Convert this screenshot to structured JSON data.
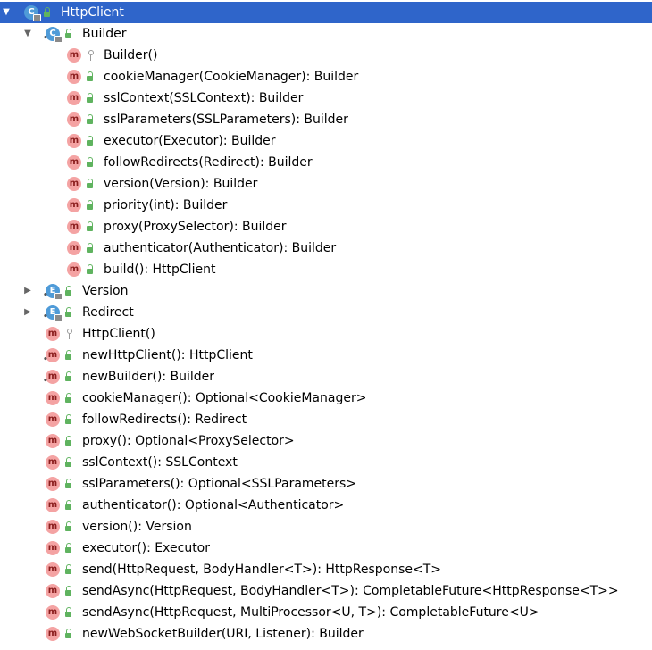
{
  "tree": [
    {
      "depth": 0,
      "arrow": "expanded",
      "kind": "c",
      "static": false,
      "vis": "public",
      "selected": true,
      "label": "HttpClient"
    },
    {
      "depth": 1,
      "arrow": "expanded",
      "kind": "c",
      "static": true,
      "vis": "public",
      "selected": false,
      "label": "Builder"
    },
    {
      "depth": 2,
      "arrow": "none",
      "kind": "m",
      "static": false,
      "vis": "private",
      "selected": false,
      "label": "Builder()"
    },
    {
      "depth": 2,
      "arrow": "none",
      "kind": "m",
      "static": false,
      "vis": "public",
      "selected": false,
      "label": "cookieManager(CookieManager): Builder"
    },
    {
      "depth": 2,
      "arrow": "none",
      "kind": "m",
      "static": false,
      "vis": "public",
      "selected": false,
      "label": "sslContext(SSLContext): Builder"
    },
    {
      "depth": 2,
      "arrow": "none",
      "kind": "m",
      "static": false,
      "vis": "public",
      "selected": false,
      "label": "sslParameters(SSLParameters): Builder"
    },
    {
      "depth": 2,
      "arrow": "none",
      "kind": "m",
      "static": false,
      "vis": "public",
      "selected": false,
      "label": "executor(Executor): Builder"
    },
    {
      "depth": 2,
      "arrow": "none",
      "kind": "m",
      "static": false,
      "vis": "public",
      "selected": false,
      "label": "followRedirects(Redirect): Builder"
    },
    {
      "depth": 2,
      "arrow": "none",
      "kind": "m",
      "static": false,
      "vis": "public",
      "selected": false,
      "label": "version(Version): Builder"
    },
    {
      "depth": 2,
      "arrow": "none",
      "kind": "m",
      "static": false,
      "vis": "public",
      "selected": false,
      "label": "priority(int): Builder"
    },
    {
      "depth": 2,
      "arrow": "none",
      "kind": "m",
      "static": false,
      "vis": "public",
      "selected": false,
      "label": "proxy(ProxySelector): Builder"
    },
    {
      "depth": 2,
      "arrow": "none",
      "kind": "m",
      "static": false,
      "vis": "public",
      "selected": false,
      "label": "authenticator(Authenticator): Builder"
    },
    {
      "depth": 2,
      "arrow": "none",
      "kind": "m",
      "static": false,
      "vis": "public",
      "selected": false,
      "label": "build(): HttpClient"
    },
    {
      "depth": 1,
      "arrow": "collapsed",
      "kind": "e",
      "static": true,
      "vis": "public",
      "selected": false,
      "label": "Version"
    },
    {
      "depth": 1,
      "arrow": "collapsed",
      "kind": "e",
      "static": true,
      "vis": "public",
      "selected": false,
      "label": "Redirect"
    },
    {
      "depth": 1,
      "arrow": "none",
      "kind": "m",
      "static": false,
      "vis": "private",
      "selected": false,
      "label": "HttpClient()"
    },
    {
      "depth": 1,
      "arrow": "none",
      "kind": "m",
      "static": true,
      "vis": "public",
      "selected": false,
      "label": "newHttpClient(): HttpClient"
    },
    {
      "depth": 1,
      "arrow": "none",
      "kind": "m",
      "static": true,
      "vis": "public",
      "selected": false,
      "label": "newBuilder(): Builder"
    },
    {
      "depth": 1,
      "arrow": "none",
      "kind": "m",
      "static": false,
      "vis": "public",
      "selected": false,
      "label": "cookieManager(): Optional<CookieManager>"
    },
    {
      "depth": 1,
      "arrow": "none",
      "kind": "m",
      "static": false,
      "vis": "public",
      "selected": false,
      "label": "followRedirects(): Redirect"
    },
    {
      "depth": 1,
      "arrow": "none",
      "kind": "m",
      "static": false,
      "vis": "public",
      "selected": false,
      "label": "proxy(): Optional<ProxySelector>"
    },
    {
      "depth": 1,
      "arrow": "none",
      "kind": "m",
      "static": false,
      "vis": "public",
      "selected": false,
      "label": "sslContext(): SSLContext"
    },
    {
      "depth": 1,
      "arrow": "none",
      "kind": "m",
      "static": false,
      "vis": "public",
      "selected": false,
      "label": "sslParameters(): Optional<SSLParameters>"
    },
    {
      "depth": 1,
      "arrow": "none",
      "kind": "m",
      "static": false,
      "vis": "public",
      "selected": false,
      "label": "authenticator(): Optional<Authenticator>"
    },
    {
      "depth": 1,
      "arrow": "none",
      "kind": "m",
      "static": false,
      "vis": "public",
      "selected": false,
      "label": "version(): Version"
    },
    {
      "depth": 1,
      "arrow": "none",
      "kind": "m",
      "static": false,
      "vis": "public",
      "selected": false,
      "label": "executor(): Executor"
    },
    {
      "depth": 1,
      "arrow": "none",
      "kind": "m",
      "static": false,
      "vis": "public",
      "selected": false,
      "label": "send(HttpRequest, BodyHandler<T>): HttpResponse<T>"
    },
    {
      "depth": 1,
      "arrow": "none",
      "kind": "m",
      "static": false,
      "vis": "public",
      "selected": false,
      "label": "sendAsync(HttpRequest, BodyHandler<T>): CompletableFuture<HttpResponse<T>>"
    },
    {
      "depth": 1,
      "arrow": "none",
      "kind": "m",
      "static": false,
      "vis": "public",
      "selected": false,
      "label": "sendAsync(HttpRequest, MultiProcessor<U, T>): CompletableFuture<U>"
    },
    {
      "depth": 1,
      "arrow": "none",
      "kind": "m",
      "static": false,
      "vis": "public",
      "selected": false,
      "label": "newWebSocketBuilder(URI, Listener): Builder"
    }
  ],
  "badge_letters": {
    "m": "m",
    "c": "C",
    "e": "E"
  },
  "colors": {
    "selection": "#2f65ca",
    "method_badge": "#f4a3a3",
    "class_badge": "#4f9bd8",
    "public_lock": "#5fb35f"
  }
}
